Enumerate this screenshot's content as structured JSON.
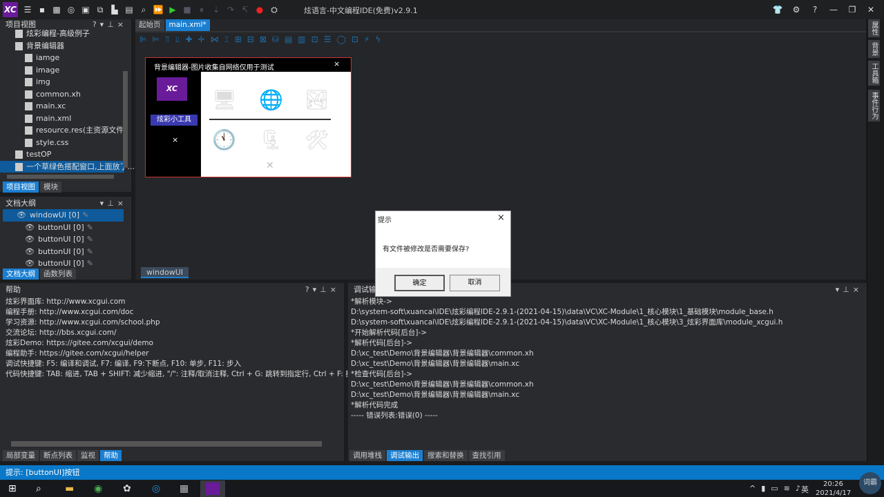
{
  "app": {
    "title": "炫语言-中文编程IDE(免费)v2.9.1",
    "logo": "XC"
  },
  "toolbar": {
    "icons": [
      "menu-icon",
      "save-icon",
      "save-all-icon",
      "run-circle-icon",
      "window-icon",
      "copy-icon",
      "paste-icon",
      "list-icon",
      "search-icon",
      "run-all-icon",
      "play-icon",
      "stop-icon",
      "pause-icon",
      "step-icon",
      "step-over-icon",
      "step-out-icon",
      "record-icon",
      "build-icon"
    ]
  },
  "window_controls": [
    "skin-icon",
    "gear-icon",
    "help-icon",
    "minimize-icon",
    "restore-icon",
    "close-icon"
  ],
  "project_panel": {
    "title": "项目视图",
    "items": [
      {
        "label": "炫彩编程-高级例子",
        "level": 0
      },
      {
        "label": "背景编辑器",
        "level": 0
      },
      {
        "label": "iamge",
        "level": 1
      },
      {
        "label": "image",
        "level": 1
      },
      {
        "label": "img",
        "level": 1
      },
      {
        "label": "common.xh",
        "level": 1
      },
      {
        "label": "main.xc",
        "level": 1
      },
      {
        "label": "main.xml",
        "level": 1
      },
      {
        "label": "resource.res(主资源文件)",
        "level": 1
      },
      {
        "label": "style.css",
        "level": 1
      },
      {
        "label": "testOP",
        "level": 0
      },
      {
        "label": "一个草绿色搭配窗口,上面放了...",
        "level": 0
      }
    ],
    "tabs": [
      "项目视图",
      "模块"
    ]
  },
  "outline_panel": {
    "title": "文档大纲",
    "items": [
      "windowUI [0]",
      "buttonUI [0]",
      "buttonUI [0]",
      "buttonUI [0]",
      "buttonUI [0]"
    ],
    "tabs": [
      "文档大纲",
      "函数列表"
    ]
  },
  "editor": {
    "tabs": [
      "起始页",
      "main.xml*"
    ],
    "bottom_tab": "windowUI",
    "design": {
      "window_title": "背景编辑器-图片收集自网络仅用于测试",
      "close": "×",
      "side_button": "炫彩小工具",
      "side_close": "×",
      "logo": "XC"
    }
  },
  "right_tabs": [
    "属性",
    "背景",
    "工具箱",
    "事件行为"
  ],
  "help_panel": {
    "title": "帮助",
    "lines": [
      "炫彩界面库: http://www.xcgui.com",
      "编程手册: http://www.xcgui.com/doc",
      "学习资源: http://www.xcgui.com/school.php",
      "交流论坛: http://bbs.xcgui.com/",
      "炫彩Demo: https://gitee.com/xcgui/demo",
      "编程助手: https://gitee.com/xcgui/helper",
      "调试快捷键: F5: 编译和调试, F7: 编译, F9:下断点, F10: 单步, F11: 步入",
      "代码快捷键: TAB: 缩进, TAB + SHIFT: 减少缩进, \"/\": 注释/取消注释, Ctrl + G: 跳转到指定行, Ctrl + F: 搜索和"
    ],
    "tabs": [
      "局部变量",
      "断点列表",
      "监视",
      "帮助"
    ]
  },
  "debug_panel": {
    "title": "调试输出",
    "lines": [
      "*解析模块->",
      "D:\\system-soft\\xuancai\\IDE\\炫彩编程IDE-2.9.1-(2021-04-15)\\data\\VC\\XC-Module\\1_核心模块\\1_基础模块\\module_base.h",
      "D:\\system-soft\\xuancai\\IDE\\炫彩编程IDE-2.9.1-(2021-04-15)\\data\\VC\\XC-Module\\1_核心模块\\3_炫彩界面库\\module_xcgui.h",
      "*开始解析代码[后台]->",
      "*解析代码[后台]->",
      "D:\\xc_test\\Demo\\背景编辑器\\背景编辑器\\common.xh",
      "D:\\xc_test\\Demo\\背景编辑器\\背景编辑器\\main.xc",
      "*检查代码[后台]->",
      "D:\\xc_test\\Demo\\背景编辑器\\背景编辑器\\common.xh",
      "D:\\xc_test\\Demo\\背景编辑器\\背景编辑器\\main.xc",
      "*解析代码完成",
      "----- 错误列表:错误(0) -----"
    ],
    "tabs": [
      "调用堆栈",
      "调试输出",
      "搜索和替换",
      "查找引用"
    ]
  },
  "status": "提示: [buttonUI]按钮",
  "dialog": {
    "title": "提示",
    "message": "有文件被修改是否需要保存?",
    "ok": "确定",
    "cancel": "取消",
    "close": "×"
  },
  "taskbar": {
    "time": "20:26",
    "date": "2021/4/17",
    "ime": "英",
    "cici": "词霸"
  }
}
